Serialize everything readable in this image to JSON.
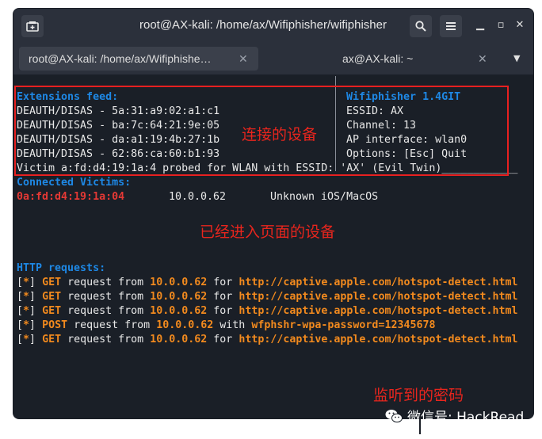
{
  "window": {
    "title": "root@AX-kali: /home/ax/Wifiphisher/wifiphisher"
  },
  "tabs": [
    {
      "label": "root@AX-kali: /home/ax/Wifiphishe…",
      "close": "✕"
    },
    {
      "label": "ax@AX-kali: ~",
      "close": "✕"
    }
  ],
  "terminal": {
    "extensions_header": "Extensions feed:",
    "extensions": [
      "DEAUTH/DISAS - 5a:31:a9:02:a1:c1",
      "DEAUTH/DISAS - ba:7c:64:21:9e:05",
      "DEAUTH/DISAS - da:a1:19:4b:27:1b",
      "DEAUTH/DISAS - 62:86:ca:60:b1:93"
    ],
    "info_title": "Wifiphisher 1.4GIT",
    "info": [
      "ESSID: AX",
      "Channel: 13",
      "AP interface: wlan0",
      "Options: [Esc] Quit"
    ],
    "probe_line": "Victim a:fd:d4:19:1a:4 probed for WLAN with ESSID: 'AX' (Evil Twin)____________",
    "victims_header": "Connected Victims:",
    "victim": {
      "mac": "0a:fd:d4:19:1a:04",
      "ip": "10.0.0.62",
      "device": "Unknown iOS/MacOS"
    },
    "http_header": "HTTP requests:",
    "http_requests": [
      {
        "bracket_open": "[",
        "star": "*",
        "bracket_close": "]",
        "method": "GET",
        "mid1": "request from",
        "ip": "10.0.0.62",
        "mid2": "for",
        "target": "http://captive.apple.com/hotspot-detect.html"
      },
      {
        "bracket_open": "[",
        "star": "*",
        "bracket_close": "]",
        "method": "GET",
        "mid1": "request from",
        "ip": "10.0.0.62",
        "mid2": "for",
        "target": "http://captive.apple.com/hotspot-detect.html"
      },
      {
        "bracket_open": "[",
        "star": "*",
        "bracket_close": "]",
        "method": "GET",
        "mid1": "request from",
        "ip": "10.0.0.62",
        "mid2": "for",
        "target": "http://captive.apple.com/hotspot-detect.html"
      },
      {
        "bracket_open": "[",
        "star": "*",
        "bracket_close": "]",
        "method": "POST",
        "mid1": "request from",
        "ip": "10.0.0.62",
        "mid2": "with",
        "target": "wfphshr-wpa-password=12345678"
      },
      {
        "bracket_open": "[",
        "star": "*",
        "bracket_close": "]",
        "method": "GET",
        "mid1": "request from",
        "ip": "10.0.0.62",
        "mid2": "for",
        "target": "http://captive.apple.com/hotspot-detect.html"
      }
    ]
  },
  "annotations": {
    "connected_devices": "连接的设备",
    "page_devices": "已经进入页面的设备",
    "captured_password": "监听到的密码"
  },
  "watermark": "微信号: HackRead",
  "colors": {
    "terminal_bg": "#1a1f27",
    "header_blue": "#1e88e5",
    "victim_red": "#e53935",
    "request_orange": "#f28a1e",
    "annotation_red": "#e8251d"
  }
}
